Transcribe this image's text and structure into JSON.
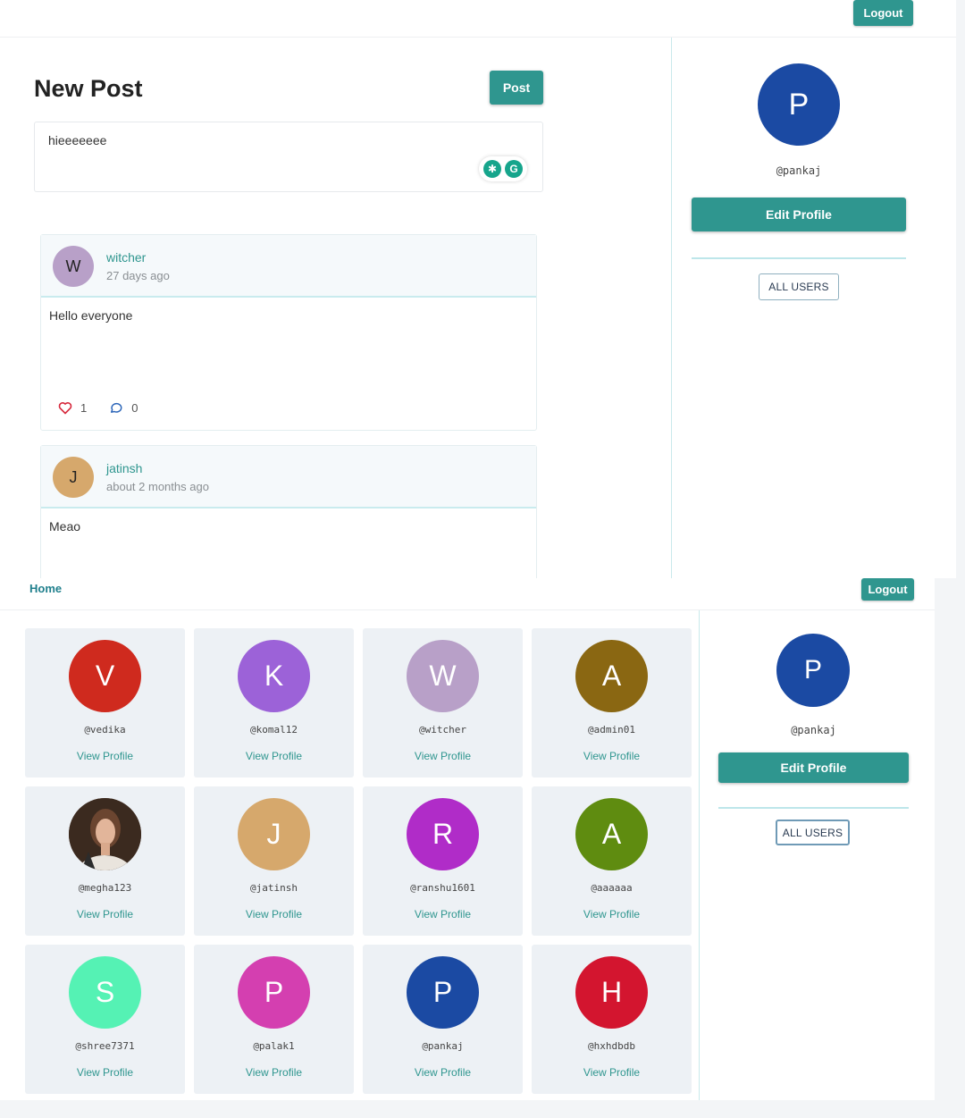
{
  "top": {
    "logout_label": "Logout",
    "new_post": {
      "title": "New Post",
      "post_button": "Post",
      "input_value": "hieeeeeee"
    },
    "posts": [
      {
        "username": "witcher",
        "time": "27 days ago",
        "initial": "W",
        "avatar_color": "#b8a0c8",
        "content": "Hello everyone",
        "likes": "1",
        "comments": "0"
      },
      {
        "username": "jatinsh",
        "time": "about 2 months ago",
        "initial": "J",
        "avatar_color": "#d6a86c",
        "content": "Meao"
      }
    ],
    "sidebar": {
      "initial": "P",
      "handle": "@pankaj",
      "edit_profile": "Edit Profile",
      "all_users": "ALL USERS"
    }
  },
  "bottom": {
    "home_label": "Home",
    "logout_label": "Logout",
    "users": [
      {
        "initial": "V",
        "handle": "@vedika",
        "color": "#cf2a1e",
        "link": "View Profile"
      },
      {
        "initial": "K",
        "handle": "@komal12",
        "color": "#9c62d8",
        "link": "View Profile"
      },
      {
        "initial": "W",
        "handle": "@witcher",
        "color": "#b8a0c8",
        "link": "View Profile"
      },
      {
        "initial": "A",
        "handle": "@admin01",
        "color": "#8a6712",
        "link": "View Profile"
      },
      {
        "initial": "",
        "handle": "@megha123",
        "color": "#5a3d2b",
        "photo": true,
        "link": "View Profile"
      },
      {
        "initial": "J",
        "handle": "@jatinsh",
        "color": "#d6a86c",
        "link": "View Profile"
      },
      {
        "initial": "R",
        "handle": "@ranshu1601",
        "color": "#b02cc8",
        "link": "View Profile"
      },
      {
        "initial": "A",
        "handle": "@aaaaaa",
        "color": "#5f8c10",
        "link": "View Profile"
      },
      {
        "initial": "S",
        "handle": "@shree7371",
        "color": "#55f2b4",
        "link": "View Profile"
      },
      {
        "initial": "P",
        "handle": "@palak1",
        "color": "#d43fb0",
        "link": "View Profile"
      },
      {
        "initial": "P",
        "handle": "@pankaj",
        "color": "#1b4aa3",
        "link": "View Profile"
      },
      {
        "initial": "H",
        "handle": "@hxhdbdb",
        "color": "#d3152f",
        "link": "View Profile"
      }
    ],
    "sidebar": {
      "initial": "P",
      "handle": "@pankaj",
      "edit_profile": "Edit Profile",
      "all_users": "ALL USERS"
    }
  },
  "colors": {
    "accent": "#2f968f",
    "link": "#1f7f8c"
  }
}
